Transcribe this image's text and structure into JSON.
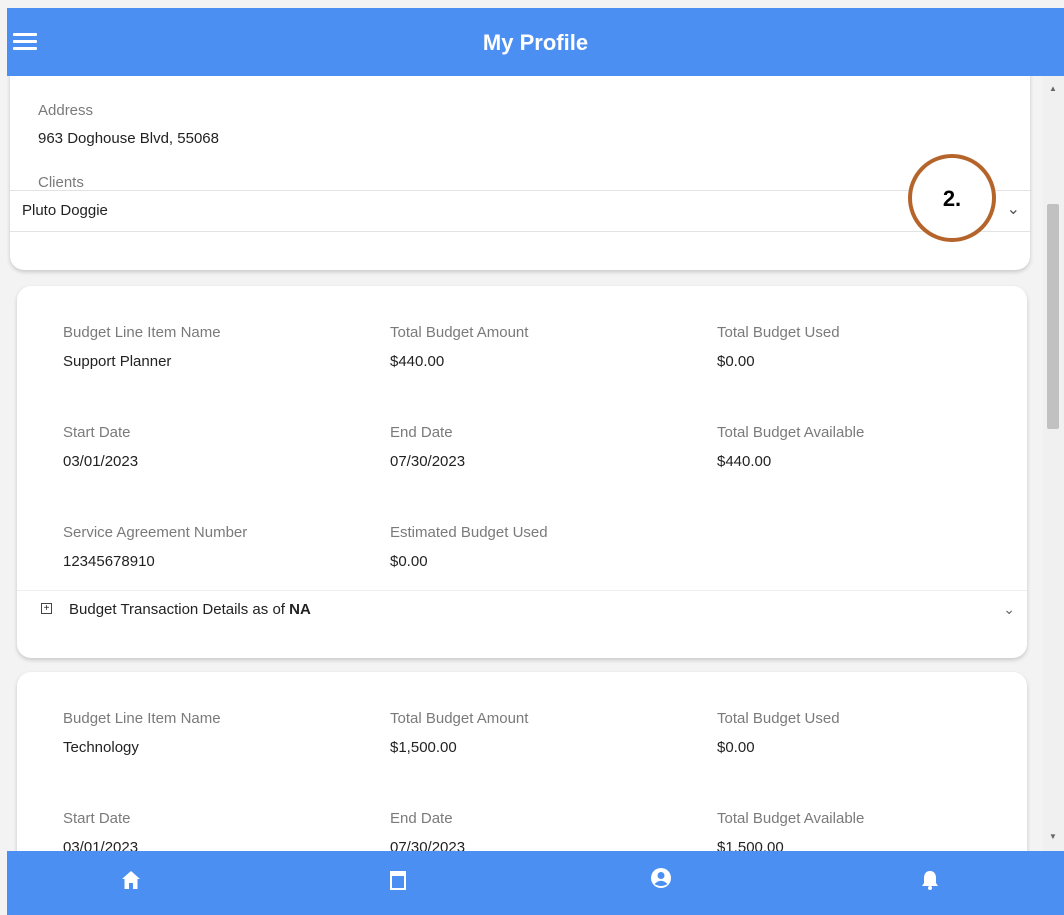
{
  "header": {
    "title": "My Profile"
  },
  "profile": {
    "address_label": "Address",
    "address_value": "963 Doghouse Blvd, 55068",
    "clients_label": "Clients",
    "client_selected": "Pluto Doggie"
  },
  "annotation": {
    "marker": "2."
  },
  "budget_items": [
    {
      "line_item_label": "Budget Line Item Name",
      "line_item_value": "Support Planner",
      "total_amount_label": "Total Budget Amount",
      "total_amount_value": "$440.00",
      "total_used_label": "Total Budget Used",
      "total_used_value": "$0.00",
      "start_label": "Start Date",
      "start_value": "03/01/2023",
      "end_label": "End Date",
      "end_value": "07/30/2023",
      "available_label": "Total Budget Available",
      "available_value": "$440.00",
      "agreement_label": "Service Agreement Number",
      "agreement_value": "12345678910",
      "estimated_label": "Estimated Budget Used",
      "estimated_value": "$0.00",
      "transaction_label": "Budget Transaction Details as of",
      "transaction_value": "NA"
    },
    {
      "line_item_label": "Budget Line Item Name",
      "line_item_value": "Technology",
      "total_amount_label": "Total Budget Amount",
      "total_amount_value": "$1,500.00",
      "total_used_label": "Total Budget Used",
      "total_used_value": "$0.00",
      "start_label": "Start Date",
      "start_value": "03/01/2023",
      "end_label": "End Date",
      "end_value": "07/30/2023",
      "available_label": "Total Budget Available",
      "available_value": "$1,500.00"
    }
  ],
  "bottom_nav": [
    "home-icon",
    "calendar-icon",
    "account-icon",
    "bell-icon"
  ],
  "colors": {
    "primary": "#4c8ff3",
    "annotation": "#b5652b",
    "background": "#f3f3f3"
  }
}
